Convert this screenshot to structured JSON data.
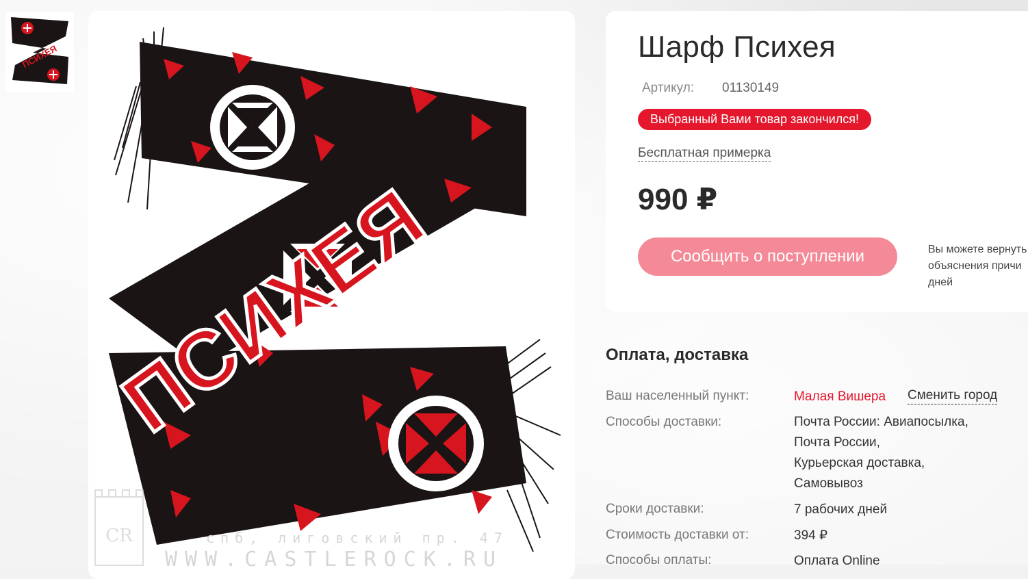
{
  "product": {
    "title": "Шарф Психея",
    "sku_label": "Артикул:",
    "sku_value": "01130149",
    "stock_badge": "Выбранный Вами товар закончился!",
    "fitting_link": "Бесплатная примерка",
    "price": "990 ₽",
    "notify_button": "Сообщить о поступлении",
    "return_note_lines": [
      "Вы можете вернуть",
      "объяснения причи",
      "дней"
    ]
  },
  "image": {
    "scarf_text": "ПСИХЕЯ",
    "watermark_line1": "спб, лиговский пр. 47",
    "watermark_line2": "WWW.CASTLEROCK.RU",
    "watermark_emblem": "CR"
  },
  "delivery": {
    "title": "Оплата, доставка",
    "rows": [
      {
        "label": "Ваш населенный пункт:",
        "value": "Малая Вишера",
        "action": "Сменить город"
      },
      {
        "label": "Способы доставки:",
        "value_lines": [
          "Почта России: Авиапосылка,",
          "Почта России,",
          "Курьерская доставка,",
          "Самовывоз"
        ]
      },
      {
        "label": "Сроки доставки:",
        "value": "7 рабочих дней"
      },
      {
        "label": "Стоимость доставки от:",
        "value": "394 ₽"
      },
      {
        "label": "Способы оплаты:",
        "value": "Оплата Online"
      }
    ]
  },
  "colors": {
    "accent_red": "#e4172c",
    "button_pink": "#f48a97",
    "scarf_black": "#1a1414",
    "scarf_red": "#d7151f"
  }
}
